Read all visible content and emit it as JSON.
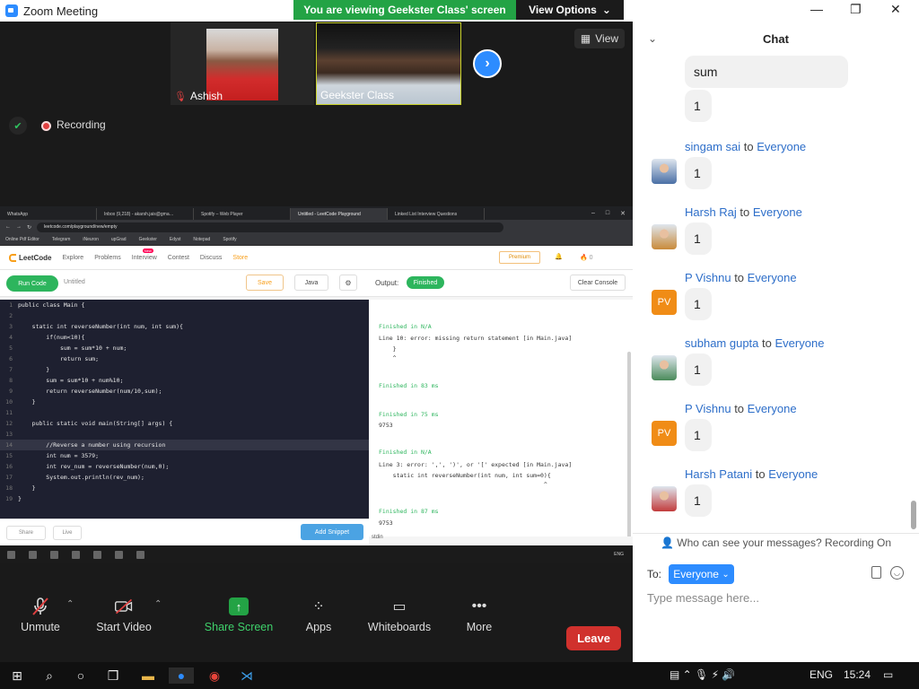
{
  "window": {
    "title": "Zoom Meeting"
  },
  "banner": {
    "viewing": "You are viewing Geekster Class' screen",
    "view_options": "View Options"
  },
  "meeting": {
    "participants": [
      {
        "name": "Ashish",
        "muted": true
      },
      {
        "name": "Geekster Class",
        "muted": false
      }
    ],
    "view_label": "View",
    "recording_label": "Recording"
  },
  "shared_screen": {
    "browser_tabs": [
      "WhatsApp",
      "Inbox (9,218) - akarsh.jais@gma…",
      "Spotify – Web Player",
      "Untitled - LeetCode Playground",
      "Linked List Interview Questions"
    ],
    "url": "leetcode.com/playground/new/empty",
    "bookmarks": [
      "Online Pdf Editor",
      "Telegram",
      "iNeuron",
      "upGrad",
      "Geekster",
      "Edyst",
      "Notepad",
      "Spotify"
    ],
    "nav": [
      "Explore",
      "Problems",
      "Interview",
      "Contest",
      "Discuss",
      "Store"
    ],
    "new_badge": "New",
    "logo": "LeetCode",
    "premium": "Premium",
    "points": "0",
    "run_code": "Run Code",
    "untitled": "Untitled",
    "save": "Save",
    "language": "Java",
    "output_label": "Output:",
    "finished_badge": "Finished",
    "clear_console": "Clear Console",
    "code_lines": [
      "public class Main {",
      "",
      "    static int reverseNumber(int num, int sum){",
      "        if(num<10){",
      "            sum = sum*10 + num;",
      "            return sum;",
      "        }",
      "        sum = sum*10 + num%10;",
      "        return reverseNumber(num/10,sum);",
      "    }",
      "",
      "    public static void main(String[] args) {",
      "",
      "        //Reverse a number using recursion",
      "        int num = 3579;",
      "        int rev_num = reverseNumber(num,0);",
      "        System.out.println(rev_num);",
      "    }",
      "}"
    ],
    "line_numbers": [
      "1",
      "2",
      "3",
      "4",
      "5",
      "6",
      "7",
      "8",
      "9",
      "10",
      "11",
      "12",
      "13",
      "14",
      "15",
      "16",
      "17",
      "18",
      "19"
    ],
    "console": [
      {
        "text": "Finished in N/A",
        "ok": true
      },
      {
        "text": "Line 10: error: missing return statement [in Main.java]",
        "ok": false
      },
      {
        "text": "    }",
        "ok": false
      },
      {
        "text": "    ^",
        "ok": false
      },
      {
        "text": "Finished in 83 ms",
        "ok": true
      },
      {
        "text": "Finished in 75 ms",
        "ok": true
      },
      {
        "text": "9753",
        "ok": false
      },
      {
        "text": "Finished in N/A",
        "ok": true
      },
      {
        "text": "Line 3: error: ',', ')', or '[' expected [in Main.java]",
        "ok": false
      },
      {
        "text": "    static int reverseNumber(int num, int sum=0){",
        "ok": false
      },
      {
        "text": "                                               ^",
        "ok": false
      },
      {
        "text": "Finished in 87 ms",
        "ok": true
      },
      {
        "text": "9753",
        "ok": false
      }
    ],
    "share": "Share",
    "live": "Live",
    "add_snippet": "Add Snippet",
    "stdin": "stdin",
    "tray": "ENG"
  },
  "controls": {
    "unmute": "Unmute",
    "start_video": "Start Video",
    "share_screen": "Share Screen",
    "apps": "Apps",
    "whiteboards": "Whiteboards",
    "more": "More",
    "leave": "Leave"
  },
  "chat": {
    "title": "Chat",
    "to_everyone": "Everyone",
    "to_word": "to",
    "top_bubble": "sum",
    "top_bubble_2": "1",
    "messages": [
      {
        "sender": "singam sai",
        "text": "1",
        "avatar": "photo"
      },
      {
        "sender": "Harsh Raj",
        "text": "1",
        "avatar": "photo"
      },
      {
        "sender": "P Vishnu",
        "text": "1",
        "avatar": "PV"
      },
      {
        "sender": "subham gupta",
        "text": "1",
        "avatar": "photo"
      },
      {
        "sender": "P Vishnu",
        "text": "1",
        "avatar": "PV"
      },
      {
        "sender": "Harsh Patani",
        "text": "1",
        "avatar": "photo"
      }
    ],
    "who_can_see": "Who can see your messages? Recording On",
    "to_label": "To:",
    "recipient": "Everyone",
    "placeholder": "Type message here..."
  },
  "taskbar": {
    "language": "ENG",
    "time": "15:24"
  },
  "colors": {
    "zoom_blue": "#2d8cff",
    "green": "#23a345",
    "leave_red": "#d0312d",
    "leetcode_orange": "#f89f1b"
  }
}
